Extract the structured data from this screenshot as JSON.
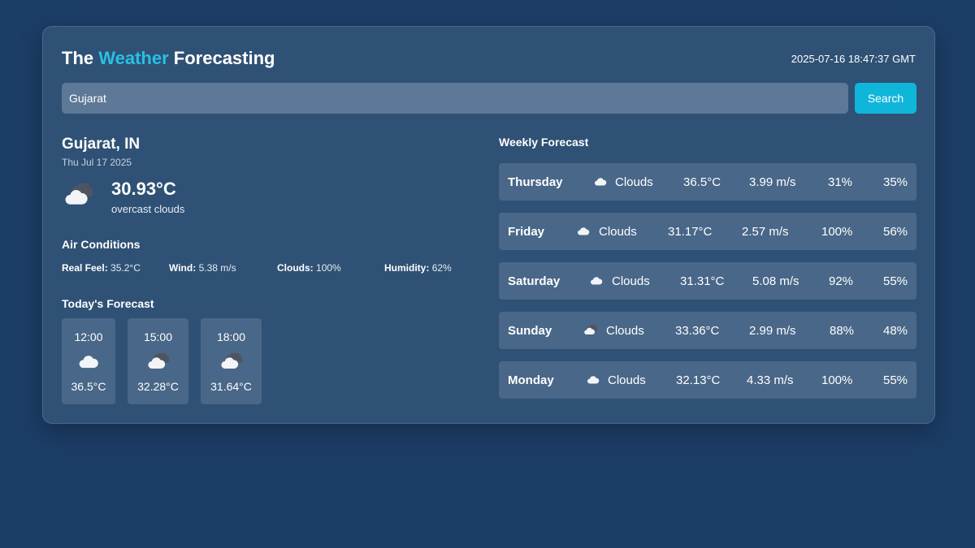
{
  "header": {
    "title_part1": "The",
    "title_accent": "Weather",
    "title_part2": "Forecasting",
    "datetime": "2025-07-16 18:47:37 GMT",
    "accent_color": "#27c1e3"
  },
  "search": {
    "value": "Gujarat",
    "button_label": "Search",
    "button_color": "#10b6d9"
  },
  "current": {
    "city": "Gujarat, IN",
    "date": "Thu Jul 17 2025",
    "temperature": "30.93°C",
    "description": "overcast clouds",
    "icon": "broken-clouds-icon"
  },
  "air_conditions": {
    "heading": "Air Conditions",
    "items": [
      {
        "label": "Real Feel:",
        "value": "35.2°C"
      },
      {
        "label": "Wind:",
        "value": "5.38 m/s"
      },
      {
        "label": "Clouds:",
        "value": "100%"
      },
      {
        "label": "Humidity:",
        "value": "62%"
      }
    ]
  },
  "today": {
    "heading": "Today's Forecast",
    "hours": [
      {
        "time": "12:00",
        "temp": "36.5°C",
        "icon": "cloud-icon"
      },
      {
        "time": "15:00",
        "temp": "32.28°C",
        "icon": "broken-clouds-icon"
      },
      {
        "time": "18:00",
        "temp": "31.64°C",
        "icon": "broken-clouds-icon"
      }
    ]
  },
  "weekly": {
    "heading": "Weekly Forecast",
    "days": [
      {
        "day": "Thursday",
        "condition": "Clouds",
        "temp": "36.5°C",
        "wind": "3.99 m/s",
        "clouds": "31%",
        "humidity": "35%",
        "icon": "cloud-icon"
      },
      {
        "day": "Friday",
        "condition": "Clouds",
        "temp": "31.17°C",
        "wind": "2.57 m/s",
        "clouds": "100%",
        "humidity": "56%",
        "icon": "cloud-icon"
      },
      {
        "day": "Saturday",
        "condition": "Clouds",
        "temp": "31.31°C",
        "wind": "5.08 m/s",
        "clouds": "92%",
        "humidity": "55%",
        "icon": "cloud-icon"
      },
      {
        "day": "Sunday",
        "condition": "Clouds",
        "temp": "33.36°C",
        "wind": "2.99 m/s",
        "clouds": "88%",
        "humidity": "48%",
        "icon": "broken-clouds-icon"
      },
      {
        "day": "Monday",
        "condition": "Clouds",
        "temp": "32.13°C",
        "wind": "4.33 m/s",
        "clouds": "100%",
        "humidity": "55%",
        "icon": "cloud-icon"
      }
    ]
  }
}
